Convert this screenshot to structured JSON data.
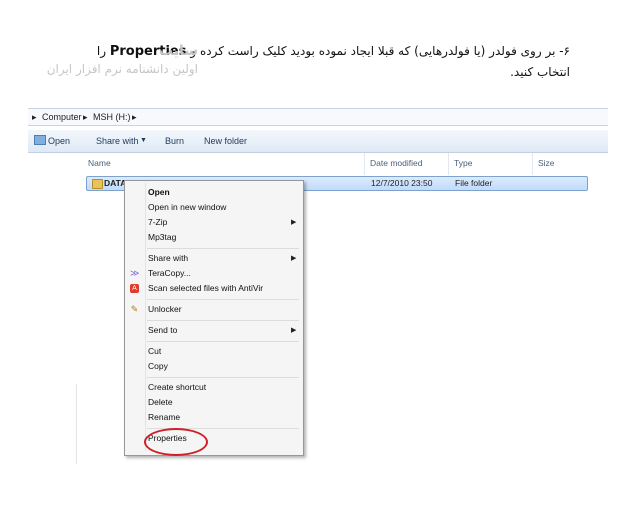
{
  "instruction": {
    "line1_prefix": "۶- بر روی فولدر (یا فولدرهایی) که قبلا ایجاد نموده بودید کلیک راست کرده و",
    "line1_keyword": "Properties",
    "line1_suffix": "را",
    "line2": "انتخاب کنید."
  },
  "watermark": {
    "line1": "سایت",
    "line2": "اولین دانشنامه نرم افزار ایران"
  },
  "explorer": {
    "breadcrumb": [
      "Computer",
      "MSH (H:)"
    ],
    "toolbar": {
      "open": "Open",
      "share_with": "Share with",
      "burn": "Burn",
      "new_folder": "New folder"
    },
    "columns": {
      "name": "Name",
      "date_modified": "Date modified",
      "type": "Type",
      "size": "Size"
    },
    "file": {
      "name": "DATA",
      "date_modified": "12/7/2010 23:50",
      "type": "File folder"
    }
  },
  "context_menu": {
    "open": "Open",
    "open_new_window": "Open in new window",
    "seven_zip": "7-Zip",
    "mp3tag": "Mp3tag",
    "share_with": "Share with",
    "teracopy": "TeraCopy...",
    "scan": "Scan selected files with AntiVir",
    "unlocker": "Unlocker",
    "send_to": "Send to",
    "cut": "Cut",
    "copy": "Copy",
    "create_shortcut": "Create shortcut",
    "delete": "Delete",
    "rename": "Rename",
    "properties": "Properties"
  }
}
